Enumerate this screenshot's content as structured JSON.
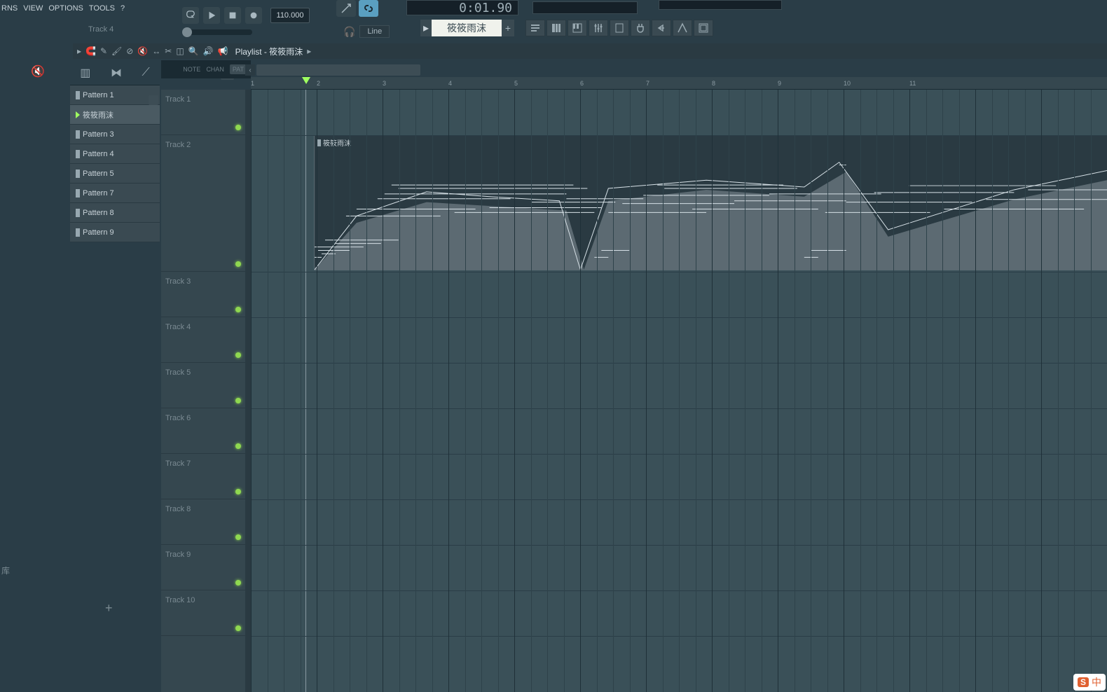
{
  "menu": {
    "items": [
      "RNS",
      "VIEW",
      "OPTIONS",
      "TOOLS",
      "?"
    ]
  },
  "hint": "Track 4",
  "tempo": "110.000",
  "time_display": "0:01.90",
  "snap": {
    "label": "Line"
  },
  "pattern_selector": {
    "name": "筱筱雨沫",
    "add": "+"
  },
  "playlist": {
    "title": "Playlist - 筱筱雨沫",
    "arrow": "▸"
  },
  "sub_tabs": {
    "note": "NOTE",
    "chan": "CHAN",
    "pat": "PAT"
  },
  "patterns": [
    {
      "label": "Pattern 1",
      "active": false
    },
    {
      "label": "筱筱雨沫",
      "active": true
    },
    {
      "label": "Pattern 3",
      "active": false
    },
    {
      "label": "Pattern 4",
      "active": false
    },
    {
      "label": "Pattern 5",
      "active": false
    },
    {
      "label": "Pattern 7",
      "active": false
    },
    {
      "label": "Pattern 8",
      "active": false
    },
    {
      "label": "Pattern 9",
      "active": false
    }
  ],
  "lib_hint": "库",
  "tracks": [
    {
      "name": "Track 1",
      "height": "normal"
    },
    {
      "name": "Track 2",
      "height": "tall"
    },
    {
      "name": "Track 3",
      "height": "normal"
    },
    {
      "name": "Track 4",
      "height": "normal"
    },
    {
      "name": "Track 5",
      "height": "normal"
    },
    {
      "name": "Track 6",
      "height": "normal"
    },
    {
      "name": "Track 7",
      "height": "normal"
    },
    {
      "name": "Track 8",
      "height": "normal"
    },
    {
      "name": "Track 9",
      "height": "normal"
    },
    {
      "name": "Track 10",
      "height": "normal"
    }
  ],
  "ruler_bars": [
    1,
    2,
    3,
    4,
    5,
    6,
    7,
    8,
    9,
    10,
    11
  ],
  "clip": {
    "label": "筱筱雨沫"
  },
  "ime": {
    "s": "S",
    "txt": "中"
  }
}
